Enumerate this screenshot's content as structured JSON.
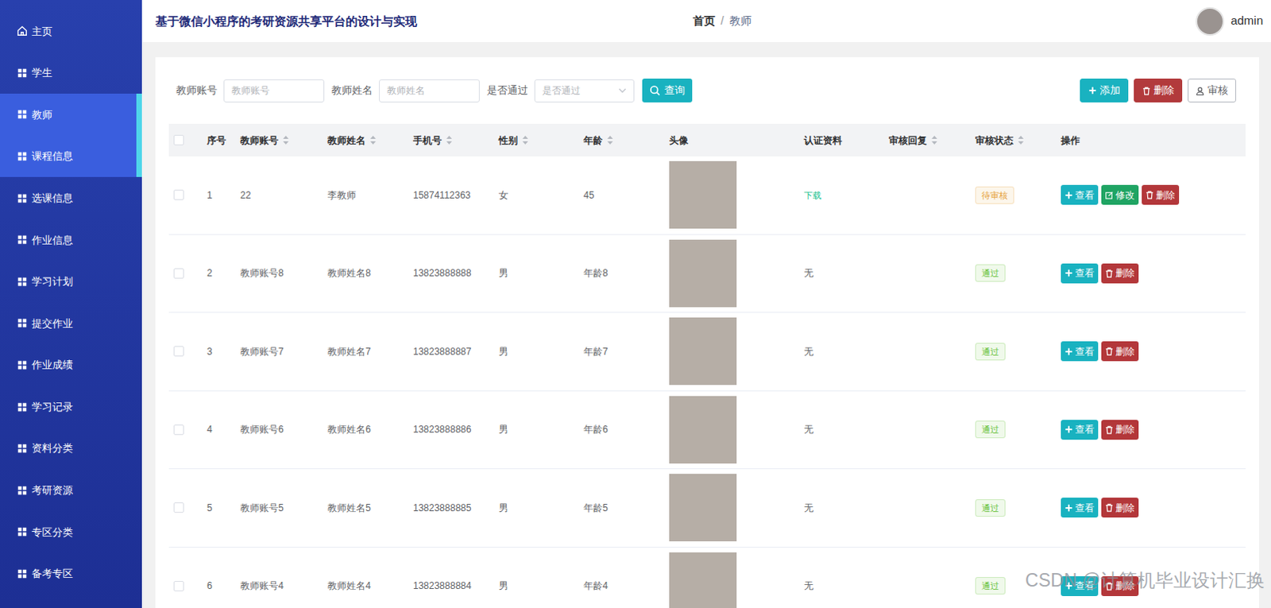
{
  "header": {
    "title": "基于微信小程序的考研资源共享平台的设计与实现",
    "breadcrumb": [
      "首页",
      "/",
      "教师"
    ],
    "user": "admin"
  },
  "sidebar": {
    "items": [
      {
        "label": "主页",
        "selected": false,
        "hovered": false
      },
      {
        "label": "学生",
        "selected": false,
        "hovered": false
      },
      {
        "label": "教师",
        "selected": true,
        "hovered": false
      },
      {
        "label": "课程信息",
        "selected": false,
        "hovered": true
      },
      {
        "label": "选课信息",
        "selected": false,
        "hovered": false
      },
      {
        "label": "作业信息",
        "selected": false,
        "hovered": false
      },
      {
        "label": "学习计划",
        "selected": false,
        "hovered": false
      },
      {
        "label": "提交作业",
        "selected": false,
        "hovered": false
      },
      {
        "label": "作业成绩",
        "selected": false,
        "hovered": false
      },
      {
        "label": "学习记录",
        "selected": false,
        "hovered": false
      },
      {
        "label": "资料分类",
        "selected": false,
        "hovered": false
      },
      {
        "label": "考研资源",
        "selected": false,
        "hovered": false
      },
      {
        "label": "专区分类",
        "selected": false,
        "hovered": false
      },
      {
        "label": "备考专区",
        "selected": false,
        "hovered": false
      }
    ]
  },
  "filters": [
    {
      "label": "教师账号",
      "placeholder": "教师账号",
      "kind": "input"
    },
    {
      "label": "教师姓名",
      "placeholder": "教师姓名",
      "kind": "input"
    },
    {
      "label": "是否通过",
      "placeholder": "是否通过",
      "kind": "select"
    }
  ],
  "search_button": "查询",
  "toolbar": [
    {
      "label": "添加",
      "kind": "add"
    },
    {
      "label": "删除",
      "kind": "delete"
    },
    {
      "label": "审核",
      "kind": "audit"
    }
  ],
  "table": {
    "header_checked": false,
    "columns": [
      {
        "label": "序号",
        "sortable": false
      },
      {
        "label": "教师账号",
        "sortable": true
      },
      {
        "label": "教师姓名",
        "sortable": true
      },
      {
        "label": "手机号",
        "sortable": true
      },
      {
        "label": "性别",
        "sortable": true
      },
      {
        "label": "年龄",
        "sortable": true
      },
      {
        "label": "头像",
        "sortable": false
      },
      {
        "label": "认证资料",
        "sortable": false
      },
      {
        "label": "审核回复",
        "sortable": true
      },
      {
        "label": "审核状态",
        "sortable": true
      },
      {
        "label": "操作",
        "sortable": false
      }
    ],
    "rows": [
      {
        "checked": false,
        "index": "1",
        "account": "22",
        "name": "李教师",
        "phone": "15874112363",
        "gender": "女",
        "age": "45",
        "cert": "下载",
        "cert_link": true,
        "status": "待审核",
        "color": "#e6a23c",
        "actions": [
          {
            "label": "查看",
            "kind": "view"
          },
          {
            "label": "修改",
            "kind": "edit"
          },
          {
            "label": "删除",
            "kind": "delete"
          }
        ]
      },
      {
        "checked": false,
        "index": "2",
        "account": "教师账号8",
        "name": "教师姓名8",
        "phone": "13823888888",
        "gender": "男",
        "age": "年龄8",
        "cert": "无",
        "cert_link": false,
        "status": "通过",
        "color": "#67c23a",
        "actions": [
          {
            "label": "查看",
            "kind": "view"
          },
          {
            "label": "删除",
            "kind": "delete"
          }
        ]
      },
      {
        "checked": false,
        "index": "3",
        "account": "教师账号7",
        "name": "教师姓名7",
        "phone": "13823888887",
        "gender": "男",
        "age": "年龄7",
        "cert": "无",
        "cert_link": false,
        "status": "通过",
        "color": "#67c23a",
        "actions": [
          {
            "label": "查看",
            "kind": "view"
          },
          {
            "label": "删除",
            "kind": "delete"
          }
        ]
      },
      {
        "checked": false,
        "index": "4",
        "account": "教师账号6",
        "name": "教师姓名6",
        "phone": "13823888886",
        "gender": "男",
        "age": "年龄6",
        "cert": "无",
        "cert_link": false,
        "status": "通过",
        "color": "#67c23a",
        "actions": [
          {
            "label": "查看",
            "kind": "view"
          },
          {
            "label": "删除",
            "kind": "delete"
          }
        ]
      },
      {
        "checked": false,
        "index": "5",
        "account": "教师账号5",
        "name": "教师姓名5",
        "phone": "13823888885",
        "gender": "男",
        "age": "年龄5",
        "cert": "无",
        "cert_link": false,
        "status": "通过",
        "color": "#67c23a",
        "actions": [
          {
            "label": "查看",
            "kind": "view"
          },
          {
            "label": "删除",
            "kind": "delete"
          }
        ]
      },
      {
        "checked": false,
        "index": "6",
        "account": "教师账号4",
        "name": "教师姓名4",
        "phone": "13823888884",
        "gender": "男",
        "age": "年龄4",
        "cert": "无",
        "cert_link": false,
        "status": "通过",
        "color": "#67c23a",
        "actions": [
          {
            "label": "查看",
            "kind": "view"
          },
          {
            "label": "删除",
            "kind": "delete"
          }
        ]
      }
    ]
  },
  "watermark": "CSDN @计算机毕业设计汇换"
}
